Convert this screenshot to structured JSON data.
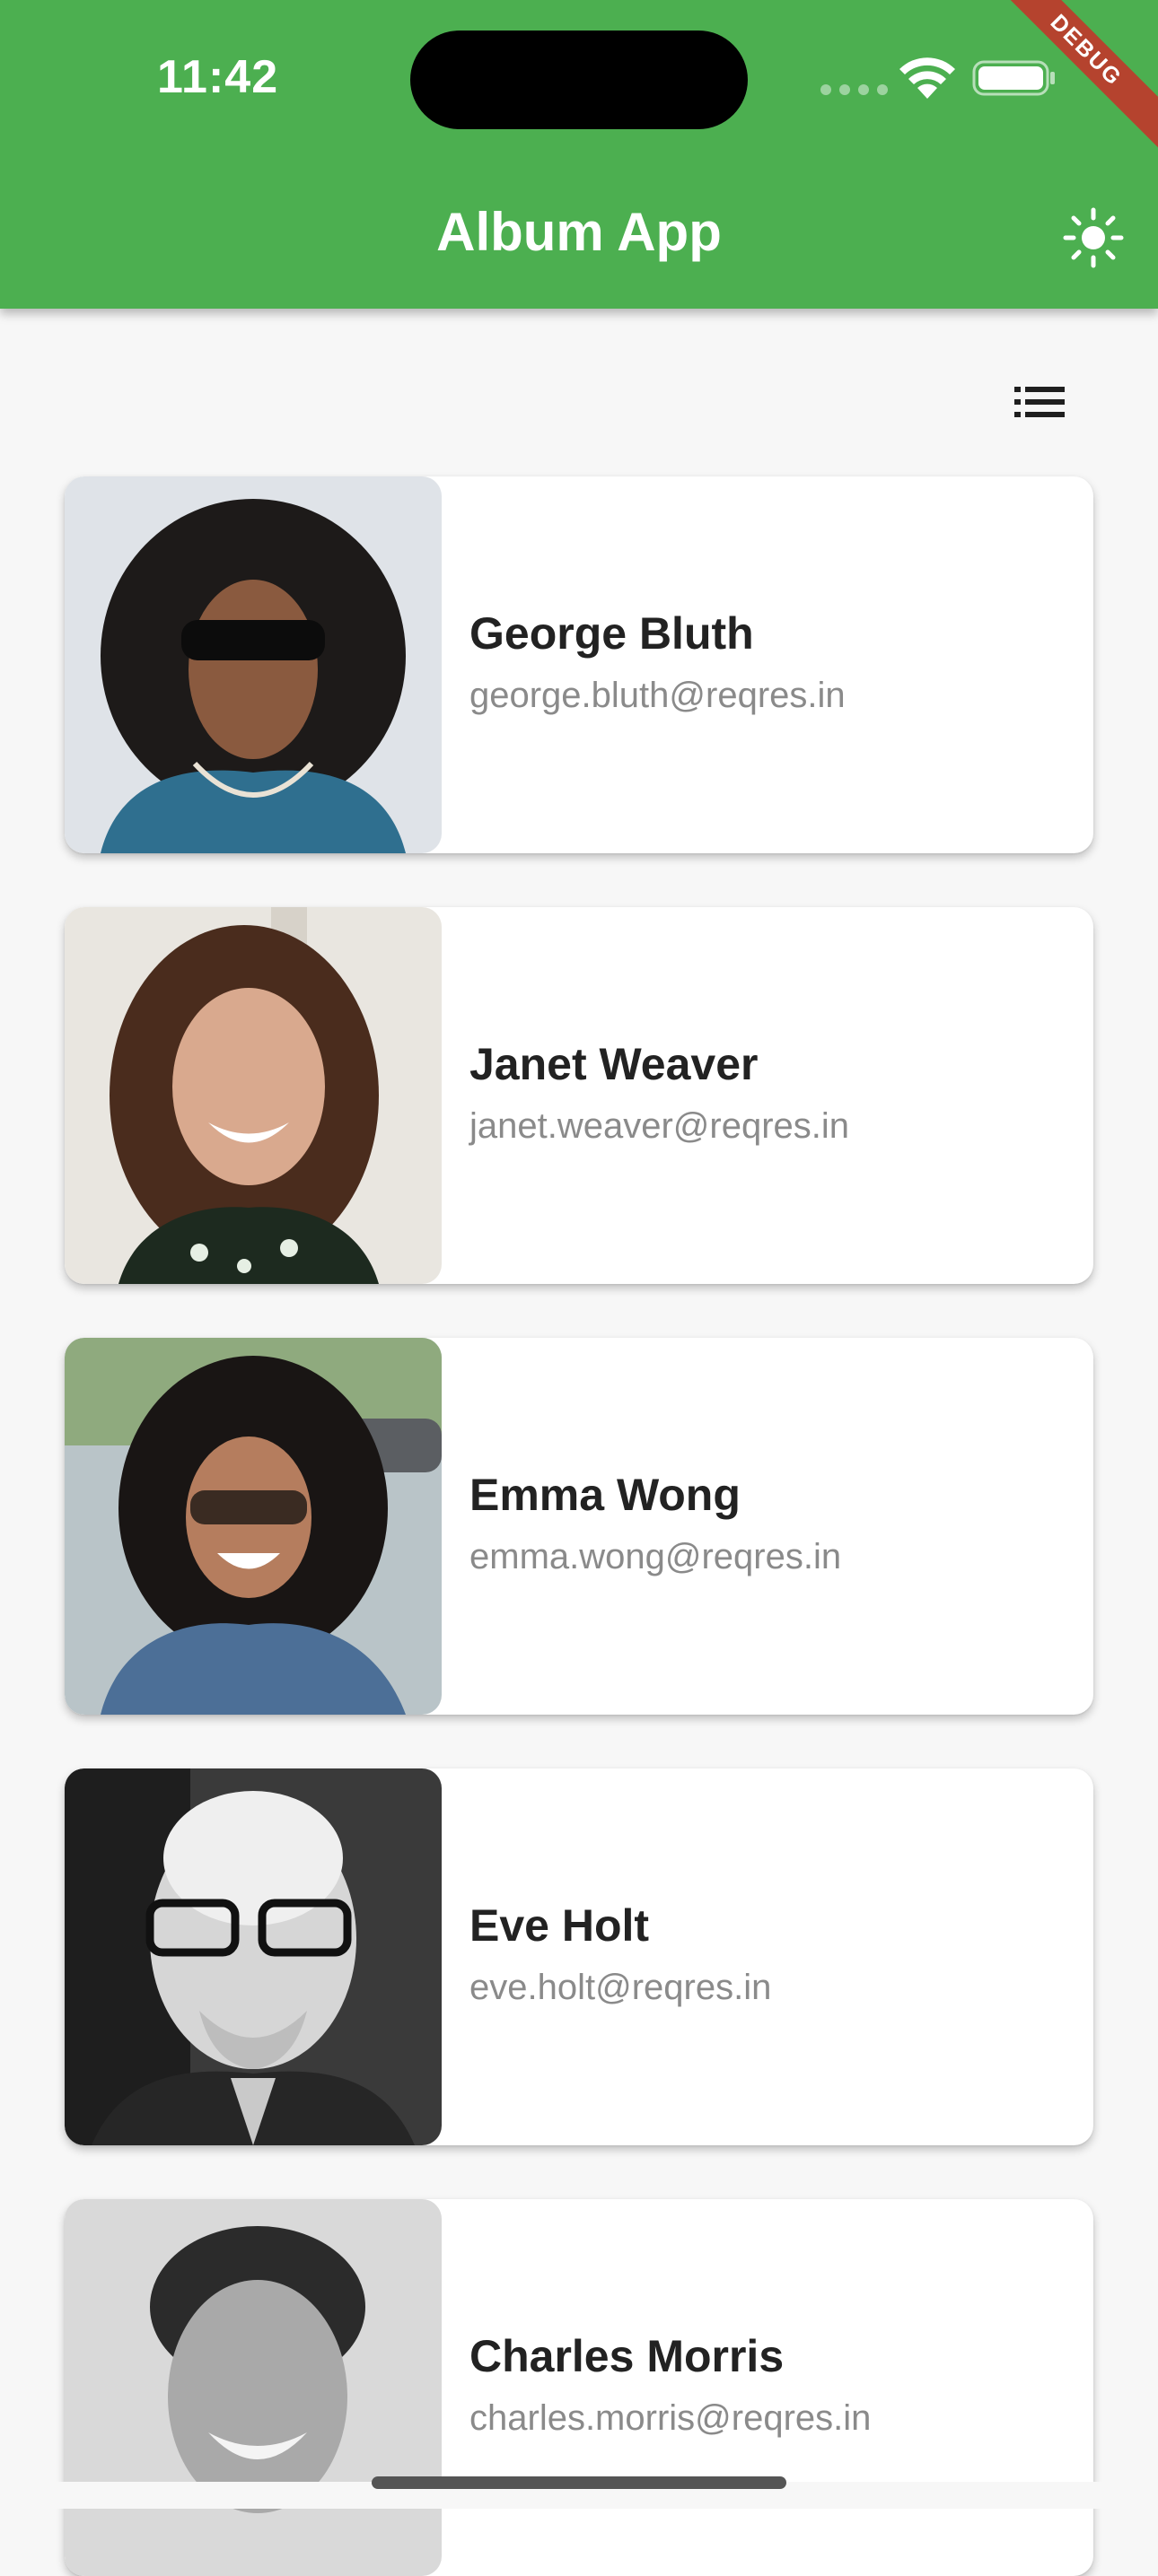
{
  "status_bar": {
    "time": "11:42",
    "debug_label": "DEBUG"
  },
  "app_bar": {
    "title": "Album App",
    "theme_icon": "sun-icon",
    "color": "#4caf50"
  },
  "toolbar": {
    "view_icon": "list-view-icon"
  },
  "users": [
    {
      "name": "George Bluth",
      "email": "george.bluth@reqres.in"
    },
    {
      "name": "Janet Weaver",
      "email": "janet.weaver@reqres.in"
    },
    {
      "name": "Emma Wong",
      "email": "emma.wong@reqres.in"
    },
    {
      "name": "Eve Holt",
      "email": "eve.holt@reqres.in"
    },
    {
      "name": "Charles Morris",
      "email": "charles.morris@reqres.in"
    }
  ]
}
